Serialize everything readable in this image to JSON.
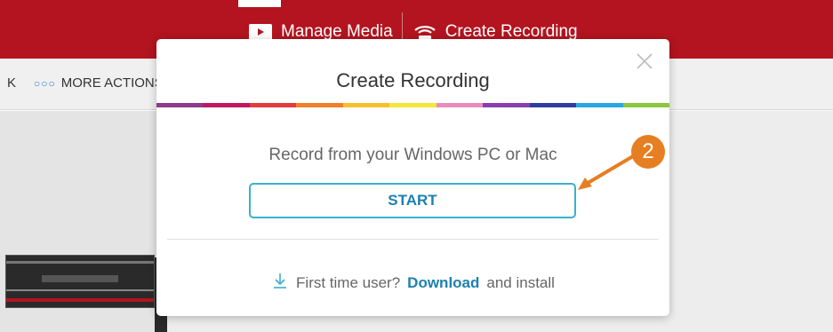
{
  "topbar": {
    "manage_media": "Manage Media",
    "create_recording": "Create Recording",
    "brand_color": "#b3141f"
  },
  "toolbar": {
    "back_fragment": "K",
    "more_actions": "MORE ACTIONS",
    "more_actions_icon": "ellipsis-dots-icon"
  },
  "modal": {
    "title": "Create Recording",
    "close_icon": "close-icon",
    "stripe_colors": [
      "#8e3b8c",
      "#c0185f",
      "#e23c3c",
      "#f07f2a",
      "#f6c02c",
      "#f0e83a",
      "#ea8cbe",
      "#8a3fae",
      "#2f3e9e",
      "#29a8e0",
      "#8ac73d"
    ],
    "prompt": "Record from your Windows PC or Mac",
    "start_label": "START",
    "footer_prefix": "First time user?",
    "footer_link": "Download",
    "footer_suffix": "and install",
    "download_icon": "download-arrow-icon"
  },
  "annotation": {
    "step_number": "2",
    "color": "#e67e22"
  }
}
